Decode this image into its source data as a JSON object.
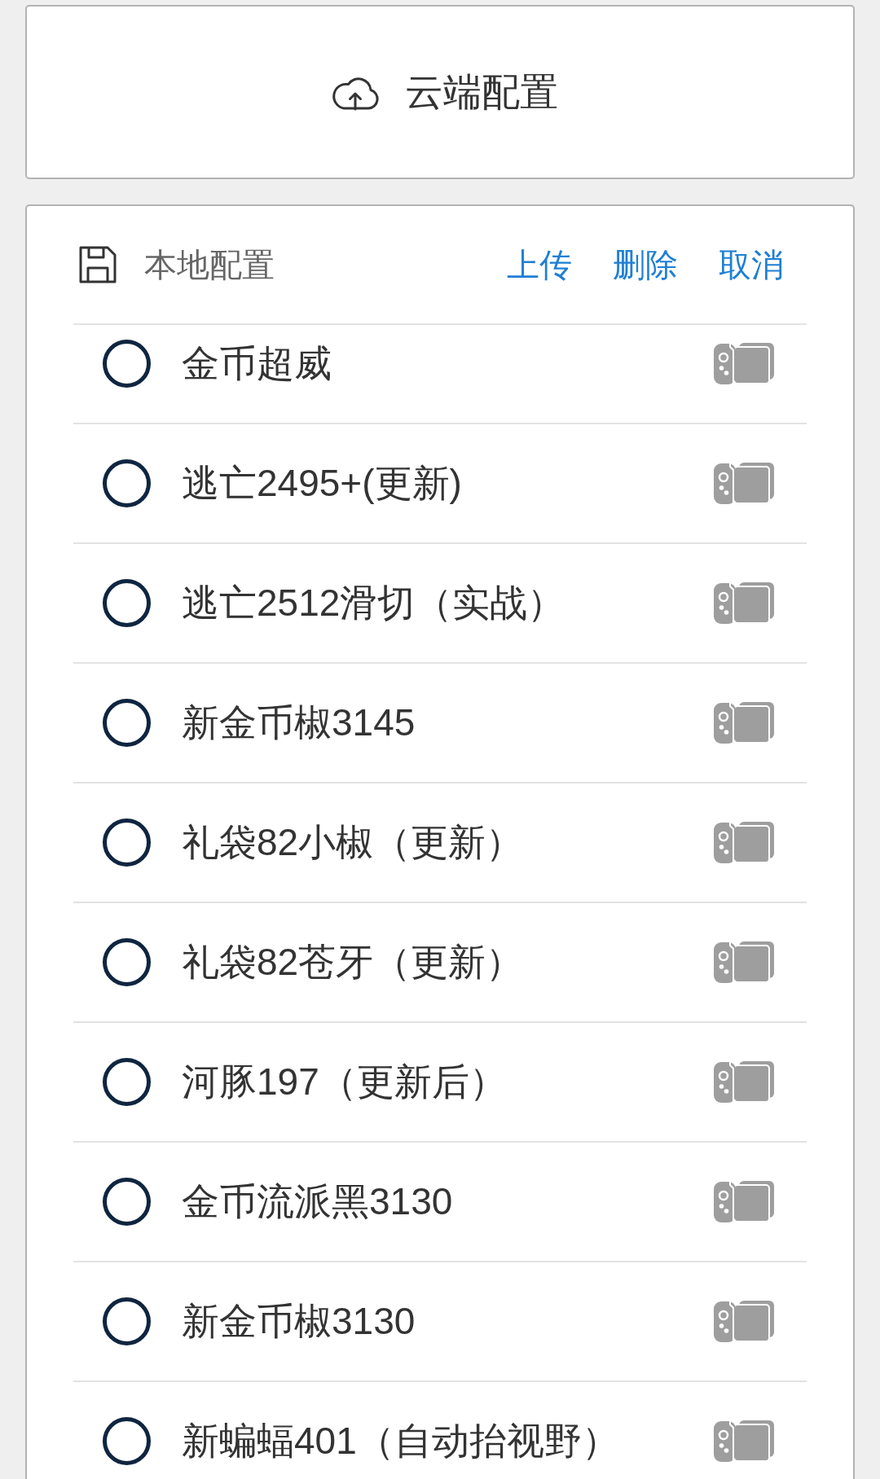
{
  "cloud_button": {
    "label": "云端配置"
  },
  "local_configs": {
    "title": "本地配置",
    "actions": [
      {
        "label": "上传"
      },
      {
        "label": "删除"
      },
      {
        "label": "取消"
      }
    ],
    "items": [
      {
        "name": "金币超威",
        "selected": false
      },
      {
        "name": "逃亡2495+(更新)",
        "selected": false
      },
      {
        "name": "逃亡2512滑切（实战）",
        "selected": false
      },
      {
        "name": "新金币椒3145",
        "selected": false
      },
      {
        "name": "礼袋82小椒（更新）",
        "selected": false
      },
      {
        "name": "礼袋82苍牙（更新）",
        "selected": false
      },
      {
        "name": "河豚197（更新后）",
        "selected": false
      },
      {
        "name": "金币流派黑3130",
        "selected": false
      },
      {
        "name": "新金币椒3130",
        "selected": false
      },
      {
        "name": "新蝙蝠401（自动抬视野）",
        "selected": false
      }
    ]
  }
}
